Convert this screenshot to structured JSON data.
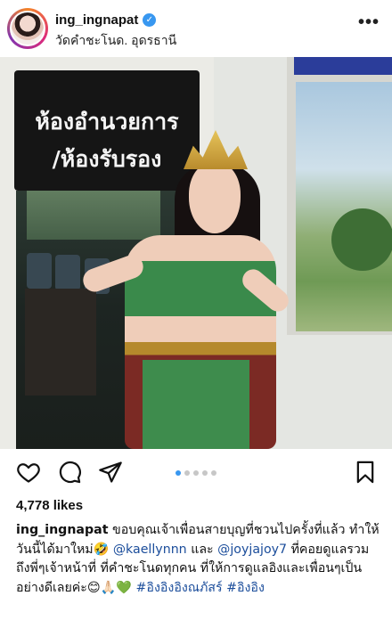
{
  "post": {
    "username": "ing_ingnapat",
    "verified_mark": "✓",
    "location": "วัดคำชะโนด. อุดรธานี",
    "more_icon": "more-options-icon",
    "more_label": "•••"
  },
  "photo": {
    "sign_line1": "ห้องอำนวยการ",
    "sign_line2": "/ห้องรับรอง"
  },
  "actions": {
    "icons": [
      "heart-icon",
      "comment-icon",
      "share-icon",
      "bookmark-icon"
    ],
    "carousel_dots": 5,
    "active_dot": 0
  },
  "likes": "4,778 likes",
  "caption": {
    "username": "ing_ingnapat",
    "text_part1": " ขอบคุณเจ้าเพื่อนสายบุญที่ชวนไปครั้งที่แล้ว ทำให้วันนี้ได้มาใหม่🤣 ",
    "mention1": "@kaellynnn",
    "text_part2": " และ ",
    "mention2": "@joyjajoy7",
    "text_part3": " ที่คอยดูแลรวมถึงพี่ๆเจ้าหน้าที่ ที่คำชะโนดทุกคน ที่ให้การดูแลอิงและเพื่อนๆเป็นอย่างดีเลยค่ะ😊🙏🏻💚 ",
    "hashtag1": "#อิงอิงอิงณภัสร์",
    "hashtag2": "#อิงอิง"
  },
  "colors": {
    "link": "#1b4d9b",
    "verified": "#3897f0",
    "active_dot": "#3897f0"
  }
}
